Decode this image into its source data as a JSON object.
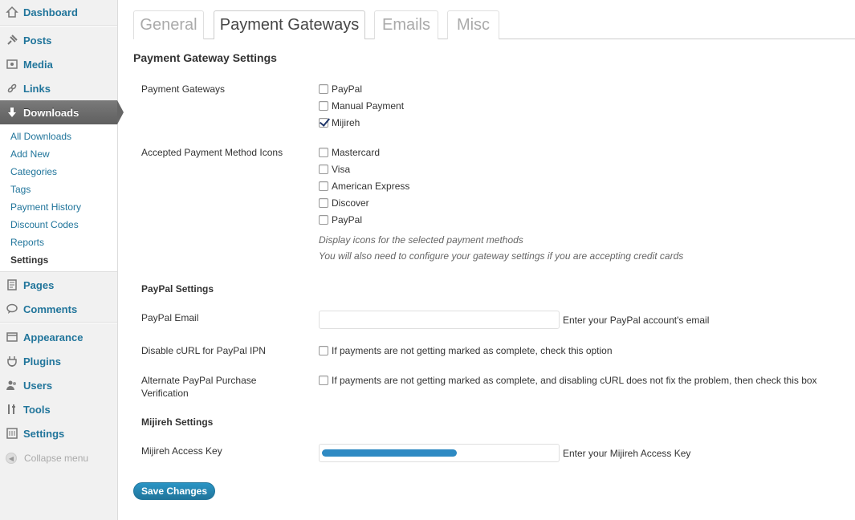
{
  "sidebar": {
    "items": {
      "dashboard": "Dashboard",
      "posts": "Posts",
      "media": "Media",
      "links": "Links",
      "downloads": "Downloads",
      "pages": "Pages",
      "comments": "Comments",
      "appearance": "Appearance",
      "plugins": "Plugins",
      "users": "Users",
      "tools": "Tools",
      "settings": "Settings"
    },
    "submenu": [
      "All Downloads",
      "Add New",
      "Categories",
      "Tags",
      "Payment History",
      "Discount Codes",
      "Reports",
      "Settings"
    ],
    "collapse_label": "Collapse menu",
    "accent_color": "#21759b"
  },
  "tabs": [
    "General",
    "Payment Gateways",
    "Emails",
    "Misc"
  ],
  "main": {
    "title": "Payment Gateway Settings",
    "payment_gateways": {
      "label": "Payment Gateways",
      "options": [
        "PayPal",
        "Manual Payment",
        "Mijireh"
      ],
      "checked": [
        false,
        false,
        true
      ]
    },
    "accepted_icons": {
      "label": "Accepted Payment Method Icons",
      "options": [
        "Mastercard",
        "Visa",
        "American Express",
        "Discover",
        "PayPal"
      ],
      "desc1": "Display icons for the selected payment methods",
      "desc2": "You will also need to configure your gateway settings if you are accepting credit cards"
    },
    "paypal_section": "PayPal Settings",
    "paypal_email": {
      "label": "PayPal Email",
      "value": "",
      "desc": "Enter your PayPal account's email"
    },
    "disable_curl": {
      "label": "Disable cURL for PayPal IPN",
      "desc": "If payments are not getting marked as complete, check this option"
    },
    "alt_verify": {
      "label_line1": "Alternate PayPal Purchase",
      "label_line2": "Verification",
      "desc": "If payments are not getting marked as complete, and disabling cURL does not fix the problem, then check this box"
    },
    "mijireh_section": "Mijireh Settings",
    "mijireh_key": {
      "label": "Mijireh Access Key",
      "desc": "Enter your Mijireh Access Key"
    },
    "save_label": "Save Changes"
  }
}
